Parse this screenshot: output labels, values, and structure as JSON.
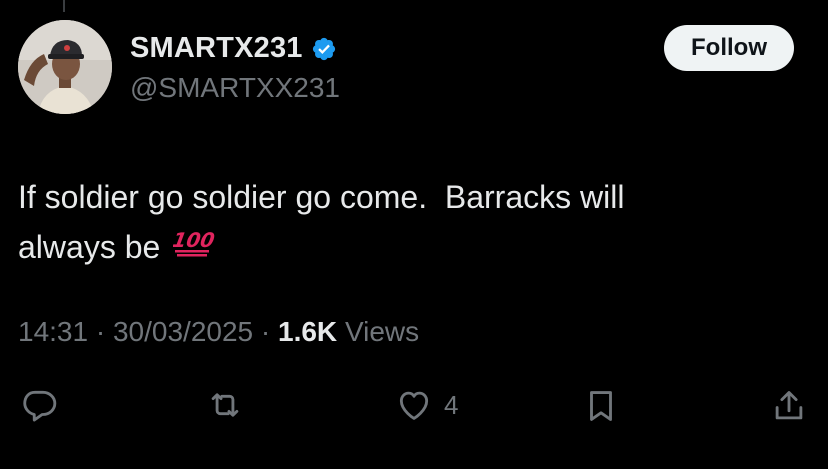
{
  "tweet": {
    "author": {
      "display_name": "SMARTX231",
      "handle": "@SMARTXX231",
      "verified": true,
      "verified_color": "#1d9bf0"
    },
    "follow_label": "Follow",
    "text_lines": [
      "If soldier go soldier go come.  Barracks will",
      "always be "
    ],
    "emoji": "💯",
    "time": "14:31",
    "date": "30/03/2025",
    "views_count": "1.6K",
    "views_label": "Views",
    "separator": " · ",
    "like_count": "4"
  },
  "icons": {
    "reply": "reply-icon",
    "retweet": "retweet-icon",
    "like": "heart-icon",
    "bookmark": "bookmark-icon",
    "share": "share-icon"
  },
  "colors": {
    "background": "#000000",
    "text_primary": "#e7e9ea",
    "text_secondary": "#71767b",
    "follow_bg": "#eff3f4"
  }
}
